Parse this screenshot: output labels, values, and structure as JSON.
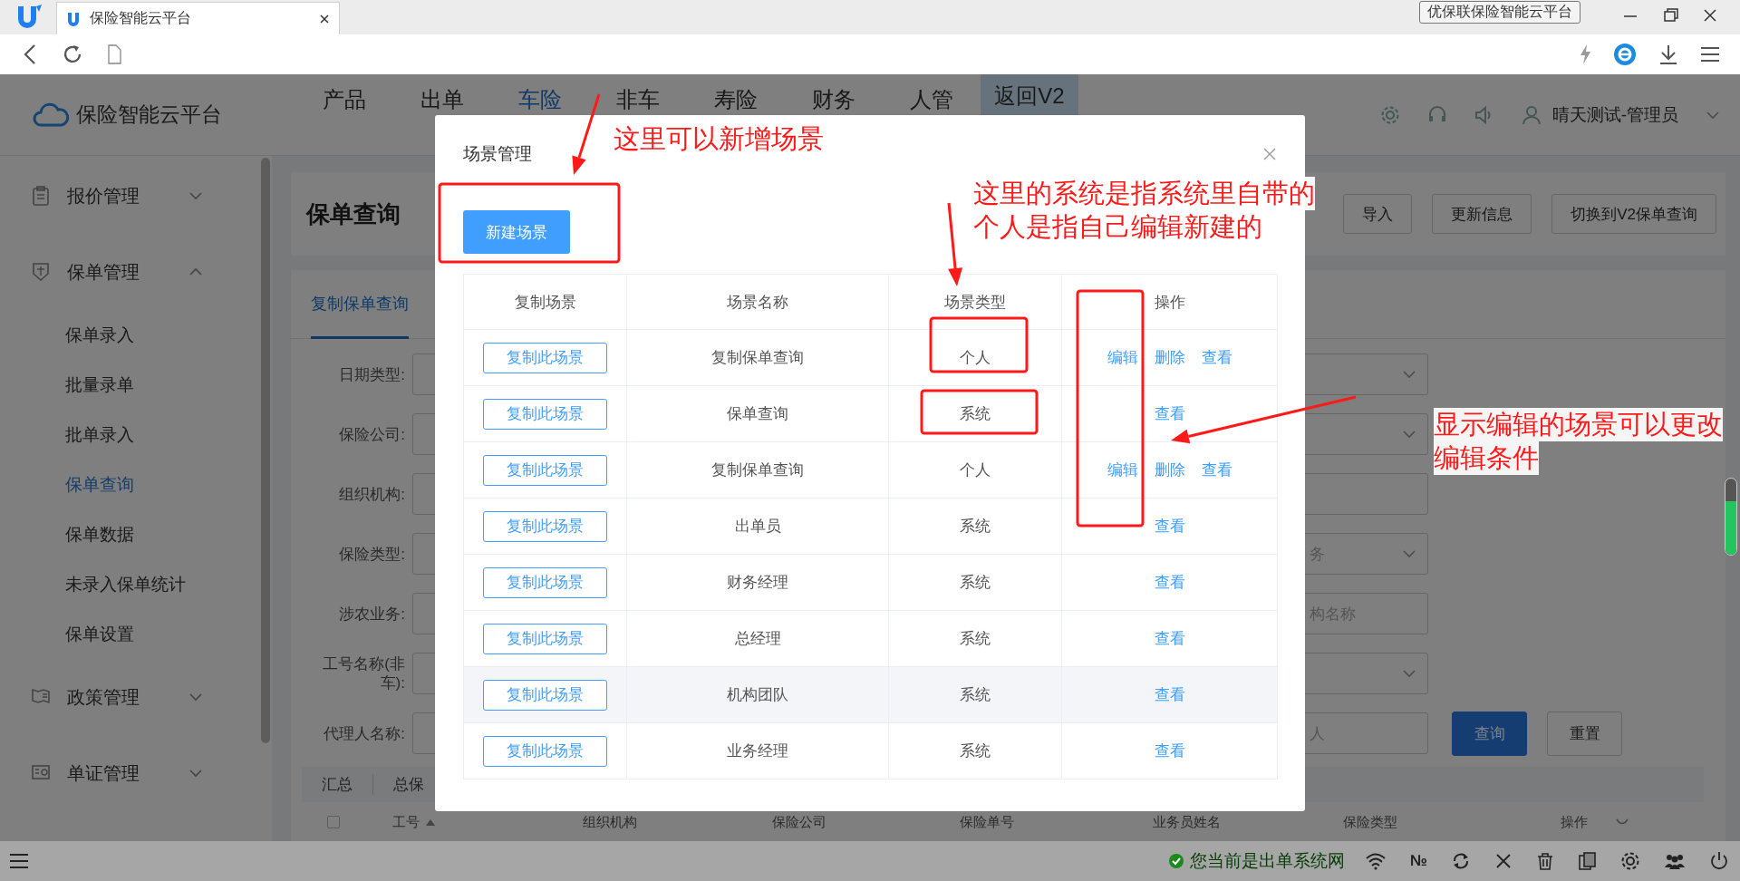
{
  "browser": {
    "tab_title": "保险智能云平台",
    "window_label": "优保联保险智能云平台"
  },
  "header": {
    "brand": "保险智能云平台",
    "user": "晴天测试-管理员",
    "nav": [
      {
        "label": "产品",
        "selected": false,
        "kind": "link"
      },
      {
        "label": "出单",
        "selected": false,
        "kind": "link"
      },
      {
        "label": "车险",
        "selected": true,
        "kind": "link"
      },
      {
        "label": "非车",
        "selected": false,
        "kind": "link"
      },
      {
        "label": "寿险",
        "selected": false,
        "kind": "link"
      },
      {
        "label": "财务",
        "selected": false,
        "kind": "link"
      },
      {
        "label": "人管",
        "selected": false,
        "kind": "link"
      },
      {
        "label": "返回V2",
        "selected": false,
        "kind": "box"
      }
    ]
  },
  "sidebar": {
    "items": [
      {
        "label": "报价管理",
        "expanded": false
      },
      {
        "label": "保单管理",
        "expanded": true,
        "children": [
          {
            "label": "保单录入",
            "selected": false
          },
          {
            "label": "批量录单",
            "selected": false
          },
          {
            "label": "批单录入",
            "selected": false
          },
          {
            "label": "保单查询",
            "selected": true
          },
          {
            "label": "保单数据",
            "selected": false
          },
          {
            "label": "未录入保单统计",
            "selected": false
          },
          {
            "label": "保单设置",
            "selected": false
          }
        ]
      },
      {
        "label": "政策管理",
        "expanded": false
      },
      {
        "label": "单证管理",
        "expanded": false
      }
    ]
  },
  "page": {
    "title": "保单查询",
    "buttons": [
      "导入",
      "更新信息",
      "切换到V2保单查询"
    ],
    "tabs": [
      {
        "label": "复制保单查询",
        "selected": true
      }
    ],
    "form": [
      {
        "label": "日期类型:",
        "right_field": {
          "kind": "select"
        }
      },
      {
        "label": "保险公司:",
        "right_field": {
          "kind": "select"
        }
      },
      {
        "label": "组织机构:",
        "right_field": {
          "kind": "input"
        }
      },
      {
        "label": "保险类型:",
        "right_field": {
          "kind": "select",
          "placeholder": "务"
        }
      },
      {
        "label": "涉农业务:",
        "right_field": {
          "kind": "input",
          "placeholder": "构名称"
        }
      },
      {
        "label": "工号名称(非车):",
        "right_field": {
          "kind": "select"
        }
      },
      {
        "label": "代理人名称:",
        "right_field": {
          "kind": "input",
          "placeholder": "人"
        }
      }
    ],
    "actions": [
      {
        "label": "查询",
        "kind": "primary"
      },
      {
        "label": "重置",
        "kind": "plain"
      }
    ],
    "summary": [
      "汇总",
      "总保"
    ],
    "table": {
      "select_all_checked": false,
      "columns": [
        "工号",
        "组织机构",
        "保险公司",
        "保险单号",
        "业务员姓名",
        "保险类型",
        "操作"
      ]
    }
  },
  "modal": {
    "title": "场景管理",
    "new_button": "新建场景",
    "columns": [
      "复制场景",
      "场景名称",
      "场景类型",
      "操作"
    ],
    "rows": [
      {
        "copy": "复制此场景",
        "name": "复制保单查询",
        "type": "个人",
        "actions": [
          "编辑",
          "删除",
          "查看"
        ],
        "highlighted": false
      },
      {
        "copy": "复制此场景",
        "name": "保单查询",
        "type": "系统",
        "actions": [
          "查看"
        ],
        "highlighted": false
      },
      {
        "copy": "复制此场景",
        "name": "复制保单查询",
        "type": "个人",
        "actions": [
          "编辑",
          "删除",
          "查看"
        ],
        "highlighted": false
      },
      {
        "copy": "复制此场景",
        "name": "出单员",
        "type": "系统",
        "actions": [
          "查看"
        ],
        "highlighted": false
      },
      {
        "copy": "复制此场景",
        "name": "财务经理",
        "type": "系统",
        "actions": [
          "查看"
        ],
        "highlighted": false
      },
      {
        "copy": "复制此场景",
        "name": "总经理",
        "type": "系统",
        "actions": [
          "查看"
        ],
        "highlighted": false
      },
      {
        "copy": "复制此场景",
        "name": "机构团队",
        "type": "系统",
        "actions": [
          "查看"
        ],
        "highlighted": true
      },
      {
        "copy": "复制此场景",
        "name": "业务经理",
        "type": "系统",
        "actions": [
          "查看"
        ],
        "highlighted": false
      }
    ]
  },
  "annotations": [
    {
      "lines": [
        "这里可以新增场景"
      ]
    },
    {
      "lines": [
        "这里的系统是指系统里自带的",
        "个人是指自己编辑新建的"
      ]
    },
    {
      "lines": [
        "显示编辑的场景可以更改",
        "编辑条件"
      ]
    }
  ],
  "status_bar": {
    "message": "您当前是出单系统网",
    "counter": "№"
  }
}
